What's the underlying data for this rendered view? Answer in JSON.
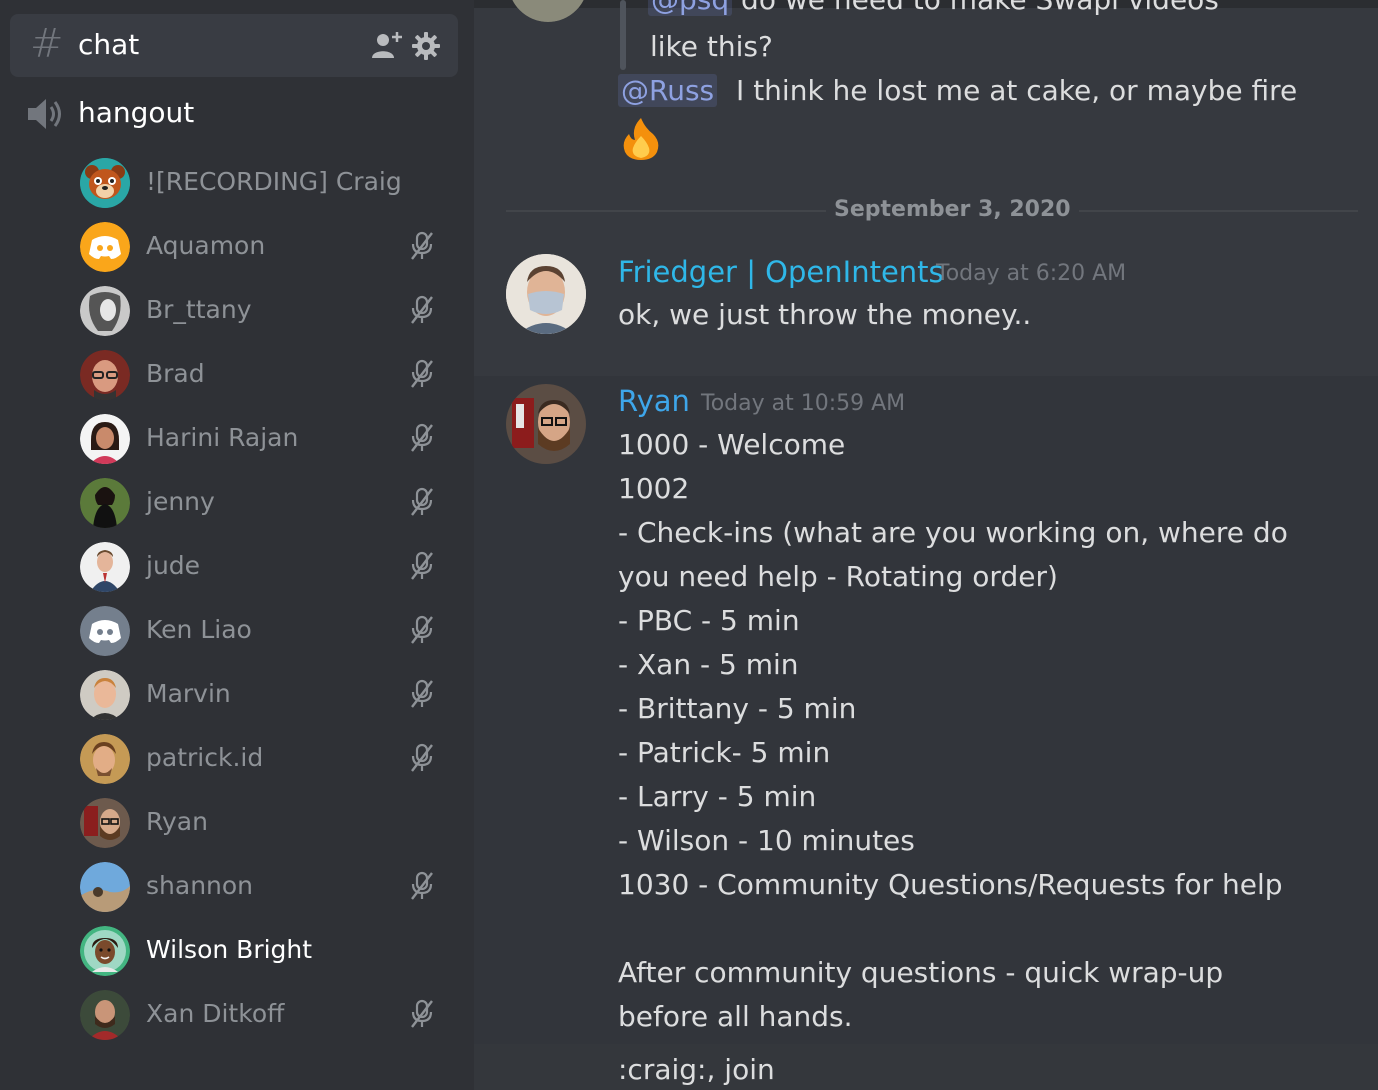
{
  "colors": {
    "sidebar_bg": "#2f3136",
    "chat_bg": "#36393f",
    "friedger_name": "#2fb7e8",
    "ryan_name": "#3ea6ea",
    "muted_text": "#8e9297",
    "mention_text": "#8ea1e1"
  },
  "channels": {
    "text_channel": {
      "name": "chat",
      "icon": "hash-icon"
    },
    "voice_channel": {
      "name": "hangout",
      "icon": "speaker-icon"
    }
  },
  "voice_members": [
    {
      "name": "![RECORDING] Craig",
      "muted": false
    },
    {
      "name": "Aquamon",
      "muted": true
    },
    {
      "name": "Br_ttany",
      "muted": true
    },
    {
      "name": "Brad",
      "muted": true
    },
    {
      "name": "Harini Rajan",
      "muted": true
    },
    {
      "name": "jenny",
      "muted": true
    },
    {
      "name": "jude",
      "muted": true
    },
    {
      "name": "Ken Liao",
      "muted": true
    },
    {
      "name": "Marvin",
      "muted": true
    },
    {
      "name": "patrick.id",
      "muted": true
    },
    {
      "name": "Ryan",
      "muted": false
    },
    {
      "name": "shannon",
      "muted": true
    },
    {
      "name": "Wilson Bright",
      "muted": false,
      "speaking": true
    },
    {
      "name": "Xan Ditkoff",
      "muted": true
    }
  ],
  "messages": {
    "partial": {
      "cutoff_line_mention": "@psq",
      "cutoff_line_text": "do we need to make Swapi videos",
      "line2": "like this?",
      "reply_mention": "@Russ",
      "reply_text": "I think he lost me at cake, or maybe fire",
      "reply_emoji": "fire-emoji"
    },
    "date_divider": "September 3, 2020",
    "friedger": {
      "author": "Friedger | OpenIntents",
      "timestamp": "Today at 6:20 AM",
      "text": "ok, we just throw the money.."
    },
    "ryan": {
      "author": "Ryan",
      "timestamp": "Today at 10:59 AM",
      "lines": [
        "1000 - Welcome",
        "1002",
        "- Check-ins (what are you working on, where do",
        "you need help - Rotating order)",
        "- PBC - 5 min",
        "- Xan - 5 min",
        "- Brittany - 5 min",
        "- Patrick- 5 min",
        "- Larry - 5 min",
        "- Wilson - 10 minutes",
        "1030 - Community Questions/Requests for help",
        "",
        "After community questions - quick wrap-up",
        "before all hands."
      ]
    },
    "next_line": ":craig:, join"
  }
}
